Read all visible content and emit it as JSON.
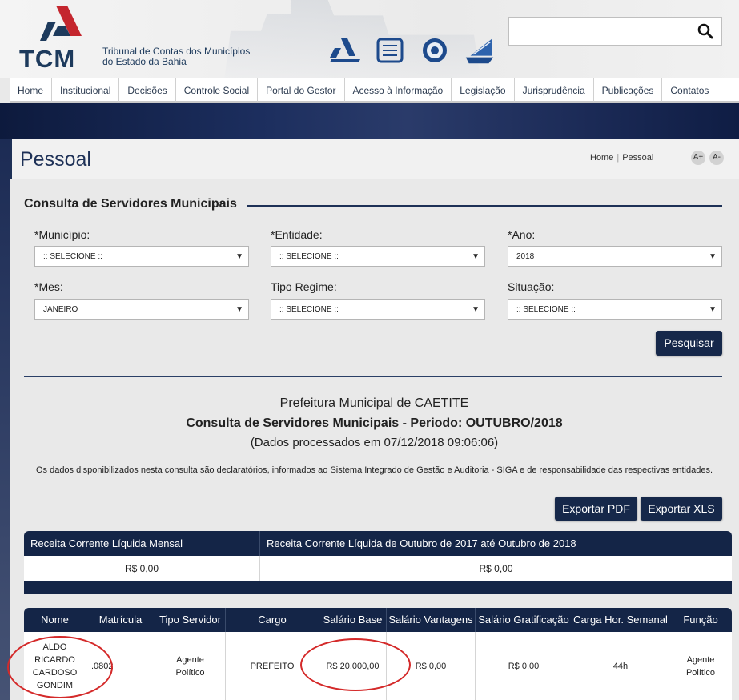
{
  "header": {
    "logo_text": "TCM",
    "logo_subtitle_line1": "Tribunal de Contas dos Municípios",
    "logo_subtitle_line2": "do Estado da Bahia",
    "search_placeholder": "",
    "partner_logos": [
      "tcm-logo",
      "book-logo",
      "seal-logo",
      "ship-logo"
    ]
  },
  "nav": {
    "items": [
      "Home",
      "Institucional",
      "Decisões",
      "Controle Social",
      "Portal do Gestor",
      "Acesso à Informação",
      "Legislação",
      "Jurisprudência",
      "Publicações",
      "Contatos"
    ]
  },
  "page": {
    "title": "Pessoal",
    "breadcrumb_home": "Home",
    "breadcrumb_current": "Pessoal",
    "font_increase": "A+",
    "font_decrease": "A-"
  },
  "form": {
    "section_title": "Consulta de Servidores Municipais",
    "fields": {
      "municipio": {
        "label": "*Município:",
        "value": ":: SELECIONE ::"
      },
      "entidade": {
        "label": "*Entidade:",
        "value": ":: SELECIONE ::"
      },
      "ano": {
        "label": "*Ano:",
        "value": "2018"
      },
      "mes": {
        "label": "*Mes:",
        "value": "JANEIRO"
      },
      "tipo_regime": {
        "label": "Tipo Regime:",
        "value": ":: SELECIONE ::"
      },
      "situacao": {
        "label": "Situação:",
        "value": ":: SELECIONE ::"
      }
    },
    "search_button": "Pesquisar"
  },
  "result": {
    "entity": "Prefeitura Municipal de CAETITE",
    "subtitle": "Consulta de Servidores Municipais - Periodo: OUTUBRO/2018",
    "processed": "(Dados processados em 07/12/2018 09:06:06)",
    "notice": "Os dados disponibilizados nesta consulta são declaratórios, informados ao Sistema Integrado de Gestão e Auditoria - SIGA e de responsabilidade das respectivas entidades.",
    "export_pdf": "Exportar PDF",
    "export_xls": "Exportar XLS"
  },
  "rcl_table": {
    "headers": [
      "Receita Corrente Líquida Mensal",
      "Receita Corrente Líquida de Outubro de 2017 até Outubro de 2018"
    ],
    "values": [
      "R$ 0,00",
      "R$ 0,00"
    ]
  },
  "servidores_table": {
    "headers": [
      "Nome",
      "Matrícula",
      "Tipo Servidor",
      "Cargo",
      "Salário Base",
      "Salário Vantagens",
      "Salário Gratificação",
      "Carga Hor. Semanal",
      "Função"
    ],
    "rows": [
      {
        "nome_lines": [
          "ALDO",
          "RICARDO",
          "CARDOSO",
          "GONDIM"
        ],
        "matricula": ".0802",
        "tipo_lines": [
          "Agente",
          "Político"
        ],
        "cargo": "PREFEITO",
        "salario_base": "R$ 20.000,00",
        "salario_vantagens": "R$ 0,00",
        "salario_gratificacao": "R$ 0,00",
        "carga": "44h",
        "funcao_lines": [
          "Agente",
          "Político"
        ]
      }
    ]
  },
  "colors": {
    "navy": "#142547",
    "annotation_red": "#d42a2a"
  }
}
